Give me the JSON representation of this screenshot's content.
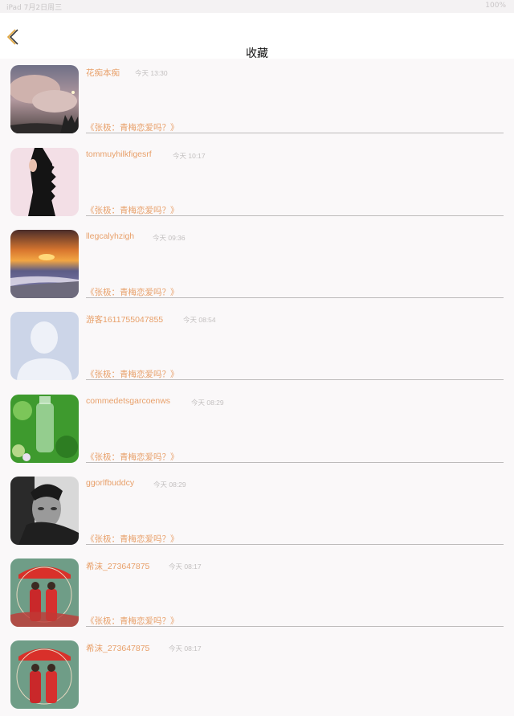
{
  "status_bar": {
    "left": "iPad  7月2日周三",
    "right": "100%"
  },
  "header": {
    "title": "收藏"
  },
  "items": [
    {
      "name": "花痴本痴",
      "time": "今天 13:30",
      "work": "《张极：青梅恋爱吗？》"
    },
    {
      "name": "tommuyhilkfigesrf",
      "time": "今天 10:17",
      "work": "《张极：青梅恋爱吗？》"
    },
    {
      "name": "llegcalyhzigh",
      "time": "今天 09:36",
      "work": "《张极：青梅恋爱吗？》"
    },
    {
      "name": "游客1611755047855",
      "time": "今天 08:54",
      "work": "《张极：青梅恋爱吗？》"
    },
    {
      "name": "commedetsgarcoenws",
      "time": "今天 08:29",
      "work": "《张极：青梅恋爱吗？》"
    },
    {
      "name": "ggorlfbuddcy",
      "time": "今天 08:29",
      "work": "《张极：青梅恋爱吗？》"
    },
    {
      "name": "希沫_273647875",
      "time": "今天 08:17",
      "work": "《张极：青梅恋爱吗？》"
    },
    {
      "name": "希沫_273647875",
      "time": "今天 08:17",
      "work": ""
    }
  ]
}
